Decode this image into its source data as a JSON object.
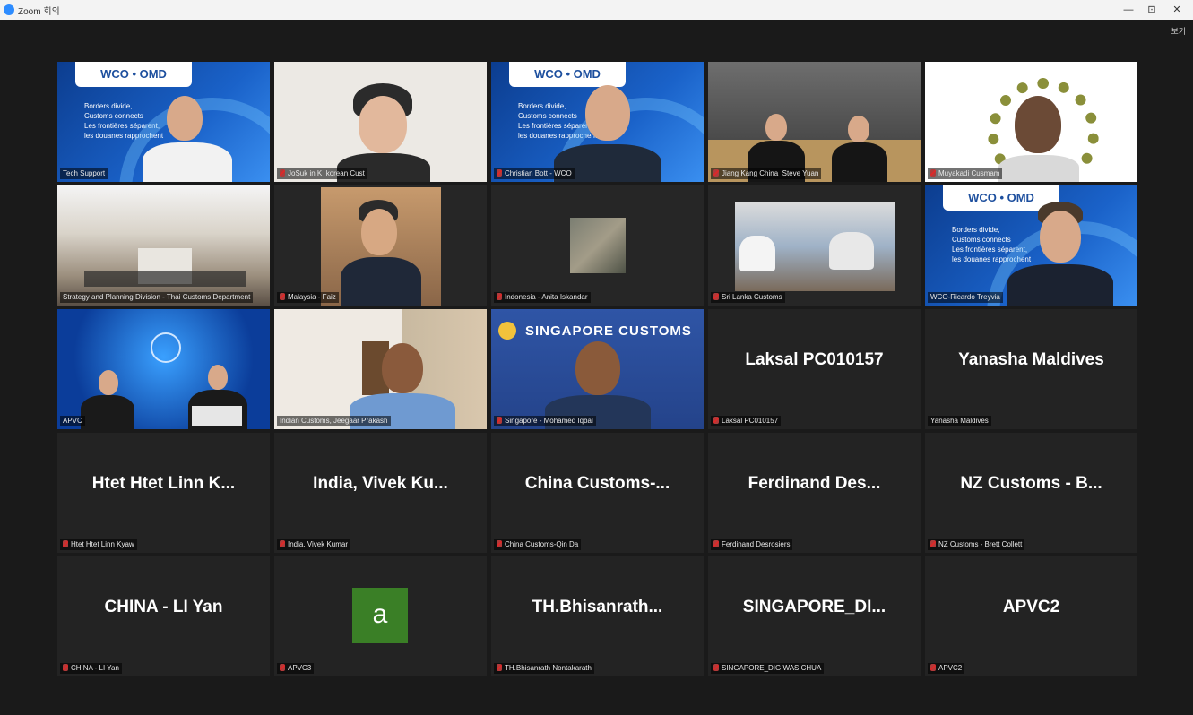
{
  "titlebar": {
    "app_title": "Zoom 회의",
    "minimize": "—",
    "maximize": "⊡",
    "close": "✕"
  },
  "meeting": {
    "view_label": "보기"
  },
  "wco": {
    "logo": "WCO • OMD",
    "line1": "Borders divide,",
    "line2": "Customs connects",
    "line3": "Les frontières séparent,",
    "line4": "les douanes rapprochent"
  },
  "singapore_banner": "SINGAPORE CUSTOMS",
  "participants": [
    {
      "label": "Tech Support"
    },
    {
      "label": "JoSuk in K_korean Cust"
    },
    {
      "label": "Christian Bott - WCO"
    },
    {
      "label": "Jiang Kang China_Steve Yuan"
    },
    {
      "label": "Muyakadi Cusmam"
    },
    {
      "label": "Strategy and Planning Division - Thai Customs Department"
    },
    {
      "label": "Malaysia - Faiz"
    },
    {
      "label": "Indonesia - Anita Iskandar"
    },
    {
      "label": "Sri Lanka Customs"
    },
    {
      "label": "WCO-Ricardo Treyvia"
    },
    {
      "label": "APVC"
    },
    {
      "label": "Indian Customs, Jeegaar Prakash"
    },
    {
      "label": "Singapore - Mohamed Iqbal"
    },
    {
      "display": "Laksal PC010157",
      "label": "Laksal PC010157"
    },
    {
      "display": "Yanasha Maldives",
      "label": "Yanasha Maldives"
    },
    {
      "display": "Htet Htet Linn K...",
      "label": "Htet Htet Linn Kyaw"
    },
    {
      "display": "India, Vivek Ku...",
      "label": "India, Vivek Kumar"
    },
    {
      "display": "China Customs-...",
      "label": "China Customs-Qin Da"
    },
    {
      "display": "Ferdinand Des...",
      "label": "Ferdinand Desrosiers"
    },
    {
      "display": "NZ Customs - B...",
      "label": "NZ Customs - Brett Collett"
    },
    {
      "display": "CHINA - LI Yan",
      "label": "CHINA - LI Yan"
    },
    {
      "avatar": "a",
      "label": "APVC3"
    },
    {
      "display": "TH.Bhisanrath...",
      "label": "TH.Bhisanrath Nontakarath"
    },
    {
      "display": "SINGAPORE_DI...",
      "label": "SINGAPORE_DIGIWAS CHUA"
    },
    {
      "display": "APVC2",
      "label": "APVC2"
    }
  ]
}
